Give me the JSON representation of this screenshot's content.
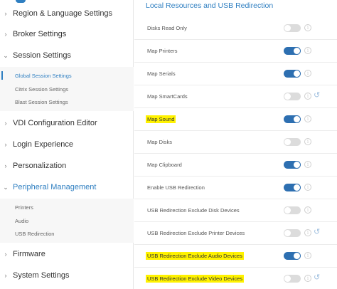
{
  "sidebar": {
    "items": [
      {
        "label": "Region & Language Settings"
      },
      {
        "label": "Broker Settings"
      },
      {
        "label": "Session Settings"
      },
      {
        "label": "VDI Configuration Editor"
      },
      {
        "label": "Login Experience"
      },
      {
        "label": "Personalization"
      },
      {
        "label": "Peripheral Management"
      },
      {
        "label": "Firmware"
      },
      {
        "label": "System Settings"
      }
    ],
    "session_sub": [
      {
        "label": "Global Session Settings"
      },
      {
        "label": "Citrix Session Settings"
      },
      {
        "label": "Blast Session Settings"
      }
    ],
    "peripheral_sub": [
      {
        "label": "Printers"
      },
      {
        "label": "Audio"
      },
      {
        "label": "USB Redirection"
      }
    ]
  },
  "main": {
    "section_title": "Local Resources and USB Redirection",
    "rows": [
      {
        "label": "Disks Read Only",
        "on": false,
        "highlight": false,
        "reset": false
      },
      {
        "label": "Map Printers",
        "on": true,
        "highlight": false,
        "reset": false
      },
      {
        "label": "Map Serials",
        "on": true,
        "highlight": false,
        "reset": false
      },
      {
        "label": "Map SmartCards",
        "on": false,
        "highlight": false,
        "reset": true
      },
      {
        "label": "Map Sound",
        "on": true,
        "highlight": true,
        "reset": false
      },
      {
        "label": "Map Disks",
        "on": false,
        "highlight": false,
        "reset": false
      },
      {
        "label": "Map Clipboard",
        "on": true,
        "highlight": false,
        "reset": false
      },
      {
        "label": "Enable USB Redirection",
        "on": true,
        "highlight": false,
        "reset": false
      },
      {
        "label": "USB Redirection Exclude Disk Devices",
        "on": false,
        "highlight": false,
        "reset": false
      },
      {
        "label": "USB Redirection Exclude Printer Devices",
        "on": false,
        "highlight": false,
        "reset": true
      },
      {
        "label": "USB Redirection Exclude Audio Devices",
        "on": true,
        "highlight": true,
        "reset": false
      },
      {
        "label": "USB Redirection Exclude Video Devices",
        "on": false,
        "highlight": true,
        "reset": true
      }
    ]
  },
  "icons": {
    "chevron": "chevron-right-icon",
    "info": "info-icon",
    "reset": "reset-icon"
  },
  "colors": {
    "accent": "#2f7fc1",
    "toggle_on": "#2d6fb1",
    "toggle_off": "#dcdcdc",
    "highlight": "#fff200"
  }
}
